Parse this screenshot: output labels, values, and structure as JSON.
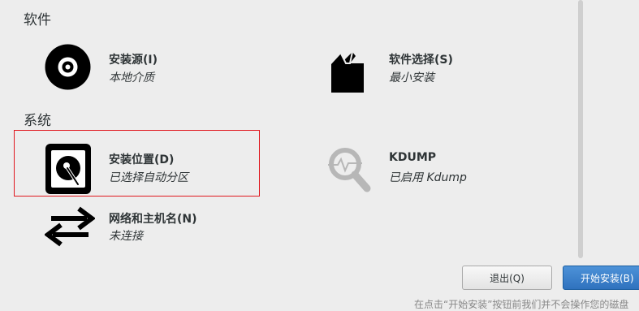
{
  "sections": {
    "software": "软件",
    "system": "系统"
  },
  "spokes": {
    "install_source": {
      "title": "安装源(I)",
      "status": "本地介质",
      "icon": "disc-icon"
    },
    "software_selection": {
      "title": "软件选择(S)",
      "status": "最小安装",
      "icon": "package-icon"
    },
    "install_destination": {
      "title": "安装位置(D)",
      "status": "已选择自动分区",
      "icon": "hard-drive-icon"
    },
    "kdump": {
      "title": "KDUMP",
      "status": "已启用 Kdump",
      "icon": "magnifier-icon"
    },
    "network": {
      "title": "网络和主机名(N)",
      "status": "未连接",
      "icon": "network-arrows-icon"
    }
  },
  "buttons": {
    "quit": "退出(Q)",
    "begin": "开始安装(B)"
  },
  "footer": {
    "note": "在点击“开始安装”按钮前我们并不会操作您的磁盘"
  },
  "colors": {
    "background": "#ededed",
    "selection_outline": "#e0181f",
    "primary_button": "#3b7fcb",
    "text": "#2e3436"
  }
}
